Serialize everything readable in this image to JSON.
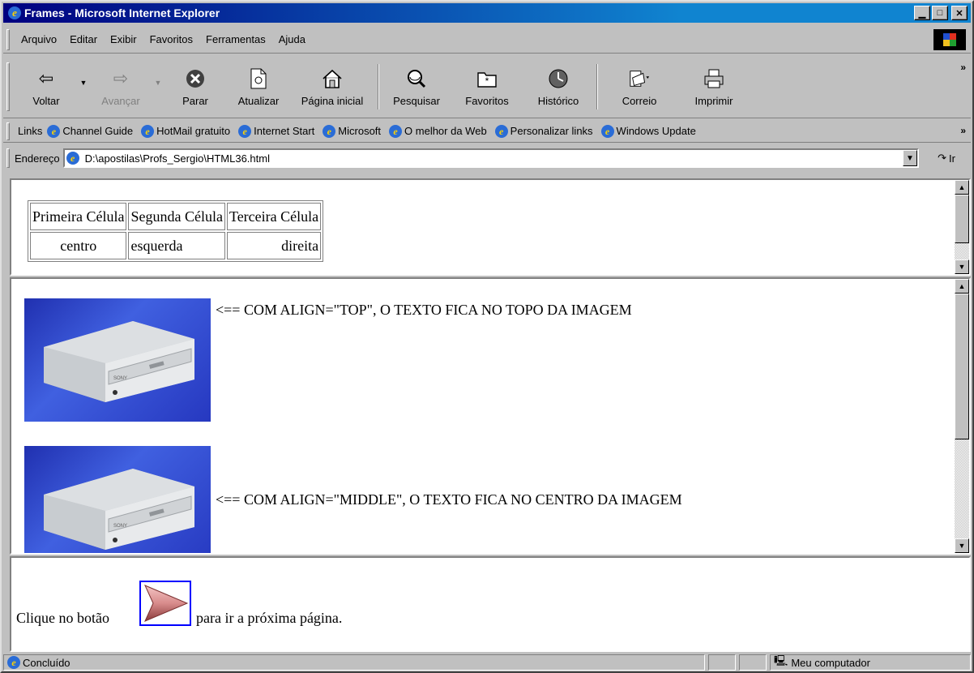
{
  "window": {
    "title": "Frames - Microsoft Internet Explorer"
  },
  "menu": [
    "Arquivo",
    "Editar",
    "Exibir",
    "Favoritos",
    "Ferramentas",
    "Ajuda"
  ],
  "toolbar": {
    "back": "Voltar",
    "forward": "Avançar",
    "stop": "Parar",
    "refresh": "Atualizar",
    "home": "Página inicial",
    "search": "Pesquisar",
    "favorites": "Favoritos",
    "history": "Histórico",
    "mail": "Correio",
    "print": "Imprimir"
  },
  "links": {
    "label": "Links",
    "items": [
      "Channel Guide",
      "HotMail gratuito",
      "Internet Start",
      "Microsoft",
      "O melhor da Web",
      "Personalizar links",
      "Windows Update"
    ]
  },
  "address": {
    "label": "Endereço",
    "value": "D:\\apostilas\\Profs_Sergio\\HTML36.html",
    "go": "Ir"
  },
  "frame1": {
    "headers": [
      "Primeira Célula",
      "Segunda Célula",
      "Terceira Célula"
    ],
    "cells": [
      "centro",
      "esquerda",
      "direita"
    ]
  },
  "frame2": {
    "top_text": "<== COM ALIGN=\"TOP\", O TEXTO FICA NO TOPO DA IMAGEM",
    "middle_text": "<== COM ALIGN=\"MIDDLE\", O TEXTO FICA NO CENTRO DA IMAGEM",
    "drive_brand": "SONY"
  },
  "frame3": {
    "before": "Clique no botão",
    "after": "para ir a próxima página."
  },
  "status": {
    "text": "Concluído",
    "zone": "Meu computador"
  }
}
